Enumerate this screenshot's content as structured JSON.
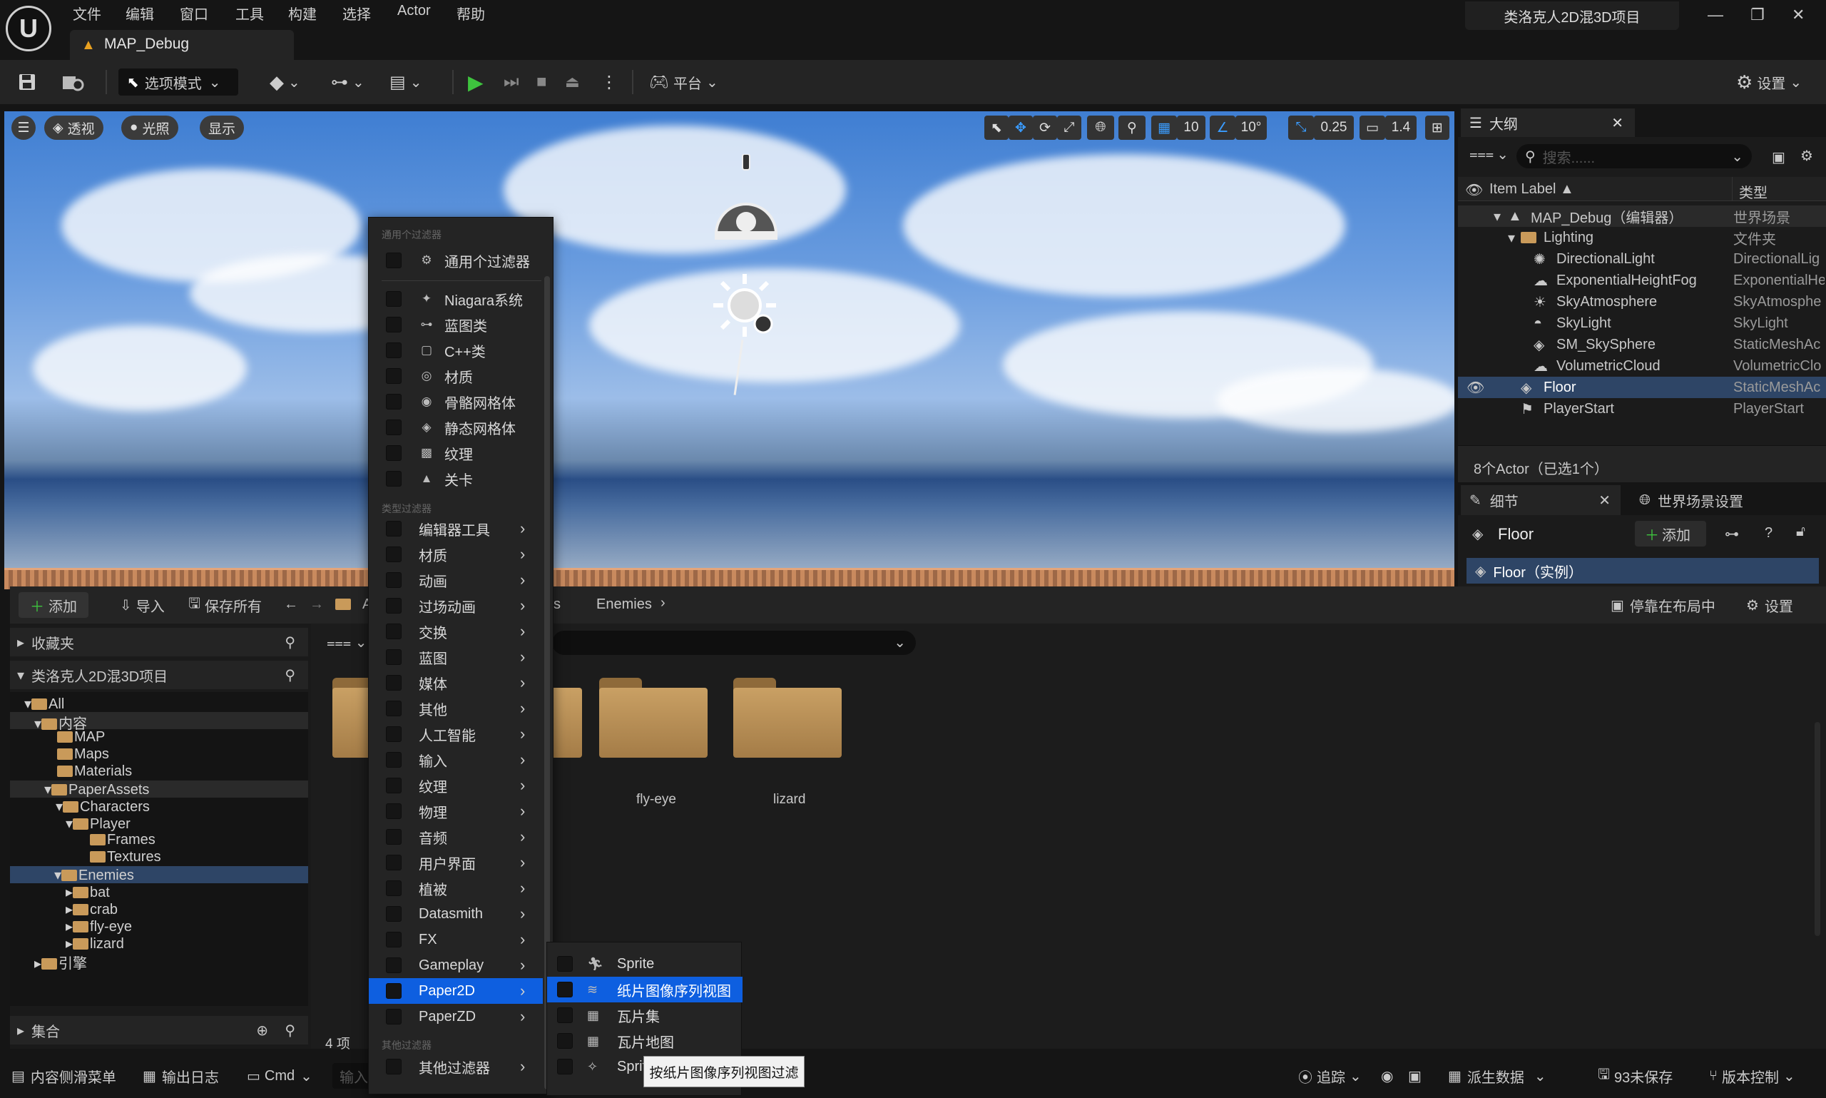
{
  "menubar": {
    "items": [
      "文件",
      "编辑",
      "窗口",
      "工具",
      "构建",
      "选择",
      "Actor",
      "帮助"
    ]
  },
  "map_tab": "MAP_Debug",
  "project_title": "类洛克人2D混3D项目",
  "toolbar": {
    "mode": "选项模式",
    "platform": "平台",
    "settings": "设置"
  },
  "viewport": {
    "perspective": "透视",
    "lighting": "光照",
    "show": "显示",
    "grid_snap": "10",
    "rotation_snap": "10°",
    "scale_snap": "0.25",
    "camera_speed": "1.4"
  },
  "outliner": {
    "tab": "大纲",
    "search_placeholder": "搜索......",
    "col_label": "Item Label ▲",
    "col_type": "类型",
    "rows": [
      {
        "label": "MAP_Debug（编辑器）",
        "type": "世界场景"
      },
      {
        "label": "Lighting",
        "type": "文件夹"
      },
      {
        "label": "DirectionalLight",
        "type": "DirectionalLig"
      },
      {
        "label": "ExponentialHeightFog",
        "type": "ExponentialHe"
      },
      {
        "label": "SkyAtmosphere",
        "type": "SkyAtmosphe"
      },
      {
        "label": "SkyLight",
        "type": "SkyLight"
      },
      {
        "label": "SM_SkySphere",
        "type": "StaticMeshAc"
      },
      {
        "label": "VolumetricCloud",
        "type": "VolumetricClo"
      },
      {
        "label": "Floor",
        "type": "StaticMeshAc"
      },
      {
        "label": "PlayerStart",
        "type": "PlayerStart"
      }
    ],
    "status": "8个Actor（已选1个）"
  },
  "details": {
    "tab": "细节",
    "world_tab": "世界场景设置",
    "object": "Floor",
    "add": "添加",
    "instance": "Floor（实例）"
  },
  "content_browser": {
    "add": "添加",
    "import": "导入",
    "save_all": "保存所有",
    "path_a": "A",
    "path_s": "s",
    "path_enemies": "Enemies",
    "dock": "停靠在布局中",
    "settings": "设置",
    "favorites": "收藏夹",
    "project": "类洛克人2D混3D项目",
    "tree": [
      "All",
      "内容",
      "MAP",
      "Maps",
      "Materials",
      "PaperAssets",
      "Characters",
      "Player",
      "Frames",
      "Textures",
      "Enemies",
      "bat",
      "crab",
      "fly-eye",
      "lizard",
      "引擎"
    ],
    "collections": "集合",
    "folders": [
      "fly-eye",
      "lizard"
    ],
    "item_count": "4 项"
  },
  "filter_menu": {
    "header_common": "通用个过滤器",
    "common": "通用个过滤器",
    "basic": [
      "Niagara系统",
      "蓝图类",
      "C++类",
      "材质",
      "骨骼网格体",
      "静态网格体",
      "纹理",
      "关卡"
    ],
    "header_type": "类型过滤器",
    "types": [
      "编辑器工具",
      "材质",
      "动画",
      "过场动画",
      "交换",
      "蓝图",
      "媒体",
      "其他",
      "人工智能",
      "输入",
      "纹理",
      "物理",
      "音频",
      "用户界面",
      "植被",
      "Datasmith",
      "FX",
      "Gameplay",
      "Paper2D",
      "PaperZD"
    ],
    "header_other": "其他过滤器",
    "other": "其他过滤器"
  },
  "submenu": {
    "items": [
      "Sprite",
      "纸片图像序列视图",
      "瓦片集",
      "瓦片地图",
      "Sprit"
    ]
  },
  "tooltip": "按纸片图像序列视图过滤",
  "statusbar": {
    "drawer": "内容侧滑菜单",
    "output": "输出日志",
    "cmd": "Cmd",
    "input_placeholder": "输入",
    "trace": "追踪",
    "derived": "派生数据",
    "unsaved": "93未保存",
    "version": "版本控制"
  }
}
